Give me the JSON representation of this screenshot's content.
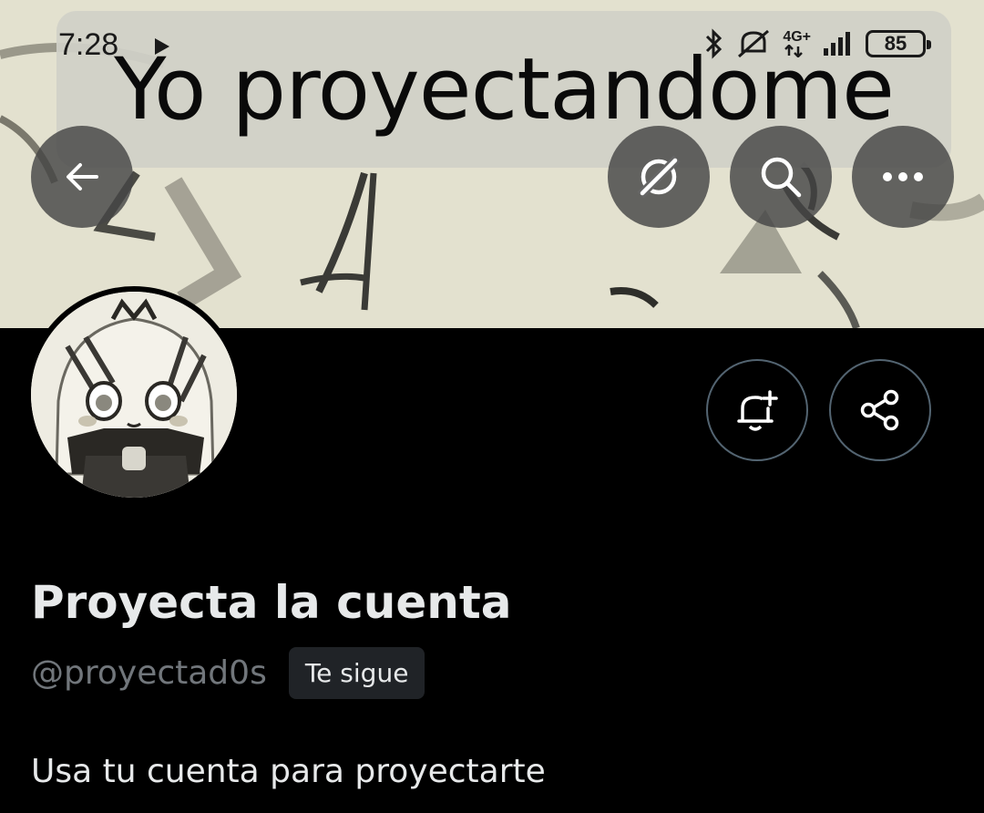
{
  "status_bar": {
    "time": "7:28",
    "network": "4G+",
    "battery": "85"
  },
  "banner": {
    "caption": "Yo proyectandome"
  },
  "toolbar": {
    "back_icon": "arrow-left-icon",
    "grok_icon": "grok-icon",
    "search_icon": "search-icon",
    "more_icon": "more-horizontal-icon"
  },
  "actions": {
    "notify_icon": "bell-plus-icon",
    "share_icon": "share-icon"
  },
  "profile": {
    "display_name": "Proyecta la cuenta",
    "handle": "@proyectad0s",
    "follows_you": "Te sigue",
    "bio": "Usa tu cuenta para proyectarte"
  },
  "colors": {
    "background": "#000000",
    "text_primary": "#e7e9ea",
    "text_secondary": "#71767b",
    "border": "#536471",
    "badge_bg": "#202327"
  }
}
